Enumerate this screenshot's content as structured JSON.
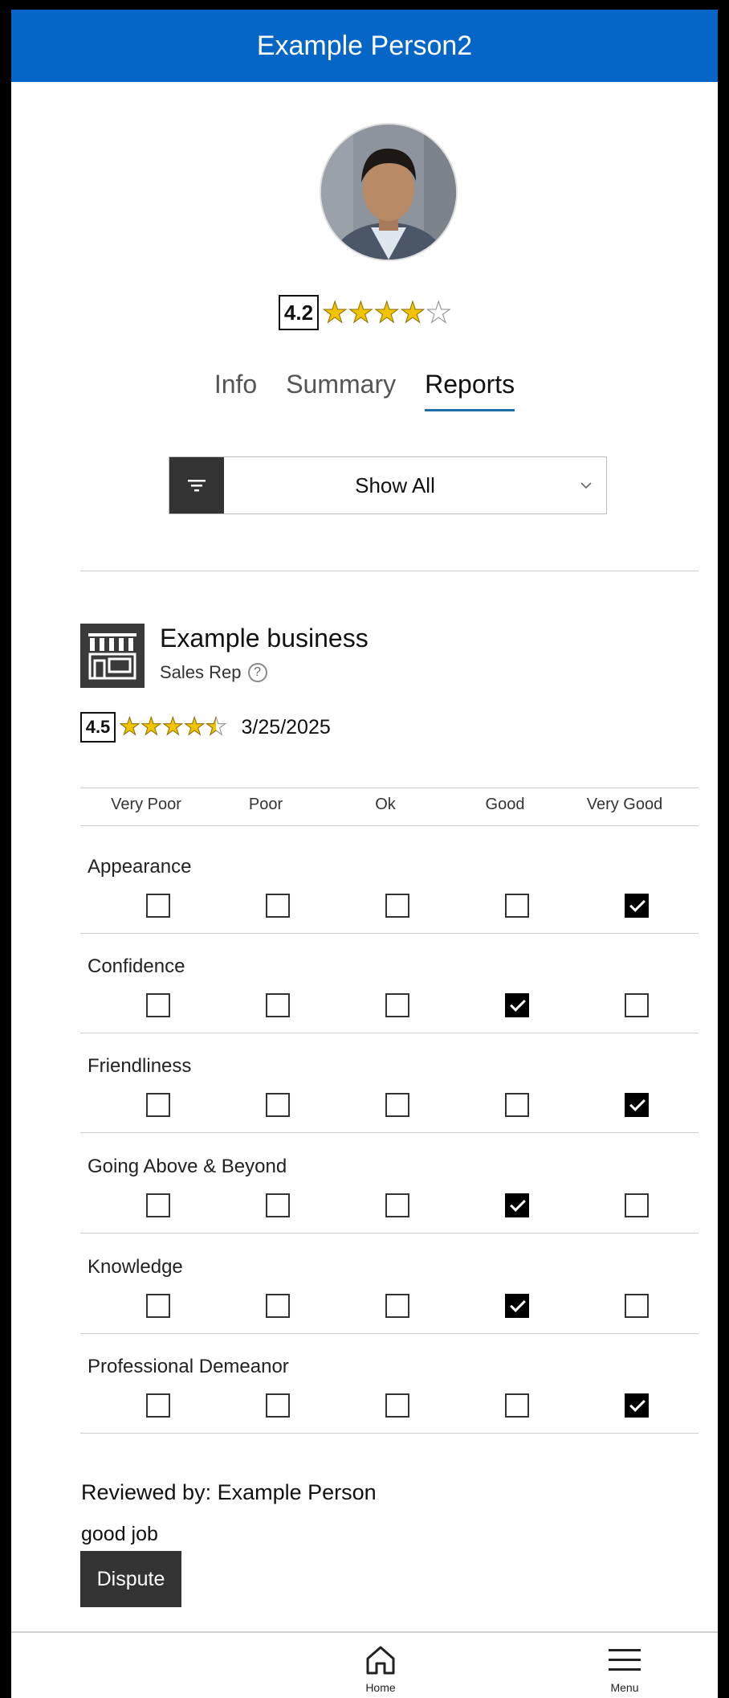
{
  "header": {
    "title": "Example Person2"
  },
  "profile": {
    "rating": "4.2",
    "stars": [
      "full",
      "full",
      "full",
      "full",
      "empty"
    ]
  },
  "tabs": [
    {
      "label": "Info",
      "active": false
    },
    {
      "label": "Summary",
      "active": false
    },
    {
      "label": "Reports",
      "active": true
    }
  ],
  "filter": {
    "selected": "Show All",
    "icon": "filter-icon"
  },
  "report": {
    "business": "Example business",
    "role": "Sales Rep",
    "help_glyph": "?",
    "rating": "4.5",
    "stars": [
      "full",
      "full",
      "full",
      "full",
      "half"
    ],
    "date": "3/25/2025",
    "columns": [
      "Very Poor",
      "Poor",
      "Ok",
      "Good",
      "Very Good"
    ],
    "categories": [
      {
        "label": "Appearance",
        "selected": 4
      },
      {
        "label": "Confidence",
        "selected": 3
      },
      {
        "label": "Friendliness",
        "selected": 4
      },
      {
        "label": "Going Above & Beyond",
        "selected": 3
      },
      {
        "label": "Knowledge",
        "selected": 3
      },
      {
        "label": "Professional Demeanor",
        "selected": 4
      }
    ],
    "reviewed_by": "Reviewed by: Example Person",
    "comment": "good job",
    "dispute_label": "Dispute"
  },
  "nav": {
    "home_label": "Home",
    "menu_label": "Menu"
  },
  "colors": {
    "header_bg": "#0566c8",
    "star": "#f2c400",
    "tab_underline": "#1c6ea8"
  }
}
